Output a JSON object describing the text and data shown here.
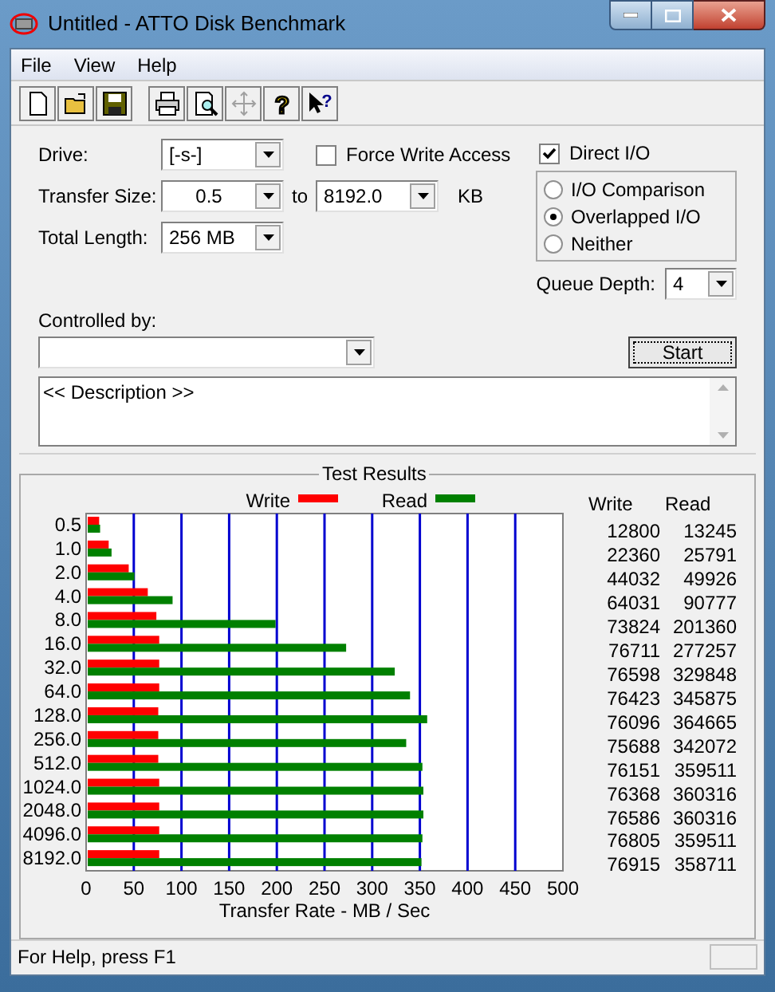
{
  "window": {
    "title": "Untitled - ATTO Disk Benchmark"
  },
  "menu": [
    "File",
    "View",
    "Help"
  ],
  "toolbar": [
    {
      "kind": "new",
      "disabled": false
    },
    {
      "kind": "open",
      "disabled": false
    },
    {
      "kind": "save",
      "disabled": false
    },
    {
      "kind": "print",
      "disabled": false
    },
    {
      "kind": "preview",
      "disabled": false
    },
    {
      "kind": "move",
      "disabled": true
    },
    {
      "kind": "help",
      "glyph": "?",
      "disabled": false
    },
    {
      "kind": "context-help",
      "glyph": "?",
      "disabled": false
    }
  ],
  "drive": {
    "label": "Drive:",
    "value": "[-s-]"
  },
  "transfer_size": {
    "label": "Transfer Size:",
    "from": "0.5",
    "to_label": "to",
    "to": "8192.0",
    "unit": "KB"
  },
  "total_length": {
    "label": "Total Length:",
    "value": "256 MB"
  },
  "force_write_access": {
    "label": "Force Write Access",
    "checked": false
  },
  "direct_io": {
    "label": "Direct I/O",
    "checked": true
  },
  "io_modes": [
    {
      "label": "I/O Comparison",
      "selected": false
    },
    {
      "label": "Overlapped I/O",
      "selected": true
    },
    {
      "label": "Neither",
      "selected": false
    }
  ],
  "queue_depth": {
    "label": "Queue Depth:",
    "value": "4"
  },
  "controlled_by": {
    "label": "Controlled by:"
  },
  "start_button": "Start",
  "description": "<< Description >>",
  "test_results": {
    "title": "Test Results",
    "table_headers": [
      "Write",
      "Read"
    ],
    "rows": [
      [
        "12800",
        "13245"
      ],
      [
        "22360",
        "25791"
      ],
      [
        "44032",
        "49926"
      ],
      [
        "64031",
        "90777"
      ],
      [
        "73824",
        "201360"
      ],
      [
        "76711",
        "277257"
      ],
      [
        "76598",
        "329848"
      ],
      [
        "76423",
        "345875"
      ],
      [
        "76096",
        "364665"
      ],
      [
        "75688",
        "342072"
      ],
      [
        "76151",
        "359511"
      ],
      [
        "76368",
        "360316"
      ],
      [
        "76586",
        "360316"
      ],
      [
        "76805",
        "359511"
      ],
      [
        "76915",
        "358711"
      ]
    ],
    "chart_data": {
      "type": "bar",
      "orientation": "horizontal",
      "xlabel": "Transfer Rate - MB / Sec",
      "legend": "top",
      "grid": true,
      "categories": [
        "0.5",
        "1.0",
        "2.0",
        "4.0",
        "8.0",
        "16.0",
        "32.0",
        "64.0",
        "128.0",
        "256.0",
        "512.0",
        "1024.0",
        "2048.0",
        "4096.0",
        "8192.0"
      ],
      "series": [
        {
          "name": "Write",
          "color": "#ff0000",
          "values": [
            12,
            22,
            43,
            63,
            72,
            75,
            75,
            75,
            74,
            74,
            74,
            75,
            75,
            75,
            75
          ]
        },
        {
          "name": "Read",
          "color": "#008000",
          "values": [
            13,
            25,
            49,
            89,
            197,
            271,
            322,
            338,
            356,
            334,
            351,
            352,
            352,
            351,
            350
          ]
        }
      ],
      "xlim": [
        0,
        500
      ],
      "xticks": [
        0,
        50,
        100,
        150,
        200,
        250,
        300,
        350,
        400,
        450,
        500
      ]
    }
  },
  "status_bar": "For Help, press F1"
}
